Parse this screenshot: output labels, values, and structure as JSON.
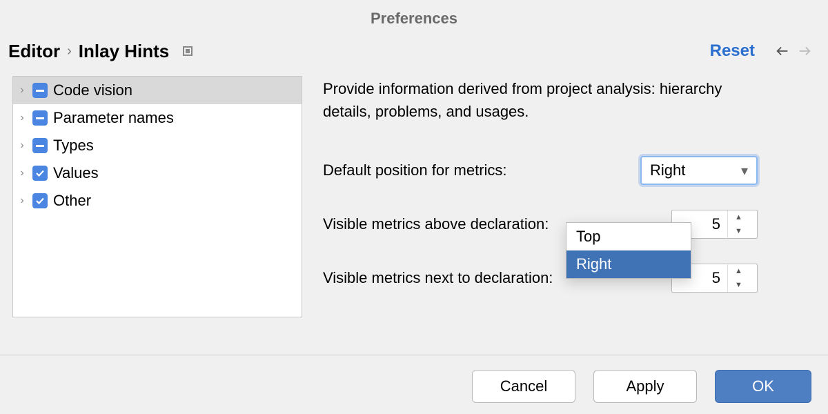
{
  "title": "Preferences",
  "breadcrumb": {
    "parent": "Editor",
    "current": "Inlay Hints"
  },
  "reset_label": "Reset",
  "tree": {
    "items": [
      {
        "label": "Code vision",
        "state": "indeterminate",
        "selected": true
      },
      {
        "label": "Parameter names",
        "state": "indeterminate",
        "selected": false
      },
      {
        "label": "Types",
        "state": "indeterminate",
        "selected": false
      },
      {
        "label": "Values",
        "state": "checked",
        "selected": false
      },
      {
        "label": "Other",
        "state": "checked",
        "selected": false
      }
    ]
  },
  "panel": {
    "description": "Provide information derived from project analysis: hierarchy details, problems, and usages.",
    "position_label": "Default position for metrics:",
    "position_value": "Right",
    "position_options": [
      "Top",
      "Right"
    ],
    "above_label": "Visible metrics above declaration:",
    "above_value": "5",
    "next_label": "Visible metrics next to declaration:",
    "next_value": "5"
  },
  "buttons": {
    "cancel": "Cancel",
    "apply": "Apply",
    "ok": "OK"
  }
}
